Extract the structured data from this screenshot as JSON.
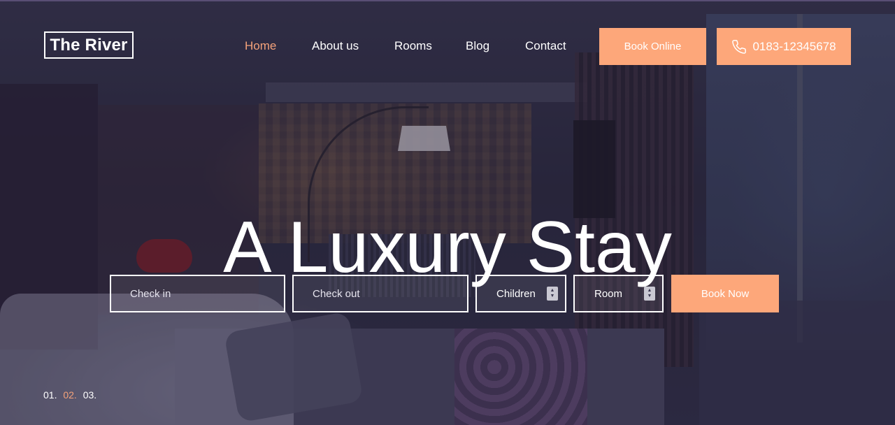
{
  "brand": {
    "logo_text": "The River"
  },
  "nav": {
    "items": [
      {
        "label": "Home",
        "active": true
      },
      {
        "label": "About us",
        "active": false
      },
      {
        "label": "Rooms",
        "active": false
      },
      {
        "label": "Blog",
        "active": false
      },
      {
        "label": "Contact",
        "active": false
      }
    ]
  },
  "header_buttons": {
    "book_online": "Book Online",
    "phone": "0183-12345678",
    "phone_icon": "phone-icon"
  },
  "hero": {
    "title": "A Luxury Stay"
  },
  "booking_form": {
    "check_in_placeholder": "Check in",
    "check_out_placeholder": "Check out",
    "children_label": "Children",
    "room_label": "Room",
    "submit_label": "Book Now"
  },
  "slider": {
    "items": [
      "01.",
      "02.",
      "03."
    ],
    "active_index": 1
  },
  "colors": {
    "accent": "#fda77a",
    "active_text": "#f4a27a",
    "text": "#ffffff"
  }
}
